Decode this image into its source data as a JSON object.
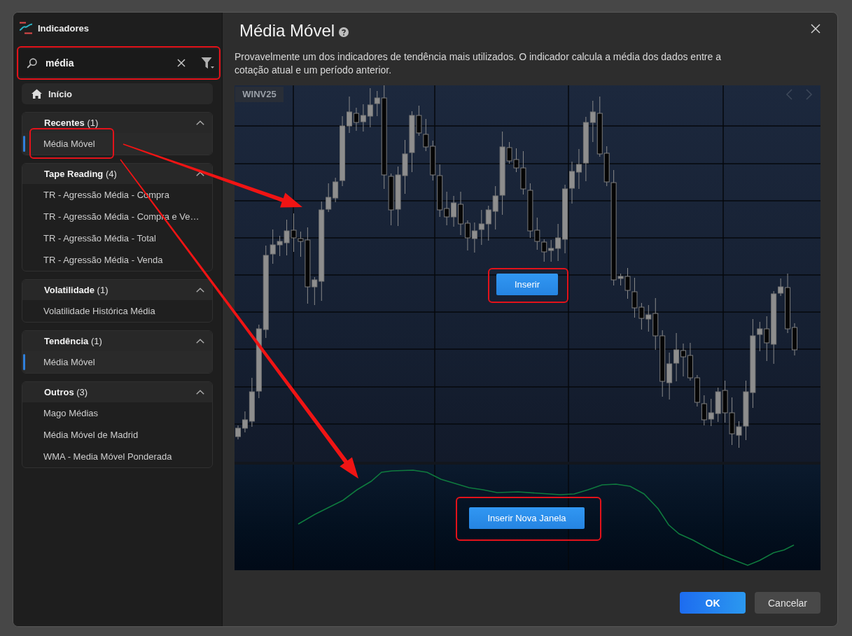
{
  "sidebar": {
    "title": "Indicadores",
    "search": {
      "value": "média"
    },
    "home": {
      "label": "Início"
    },
    "groups": [
      {
        "label": "**Recentes** (1)",
        "expanded": true,
        "items": [
          {
            "label": "Média Móvel",
            "selected": true
          }
        ]
      },
      {
        "label": "**Tape Reading** (4)",
        "expanded": true,
        "items": [
          {
            "label": "TR - Agressão Média - Compra",
            "selected": false
          },
          {
            "label": "TR - Agressão Média - Compra e Ve…",
            "selected": false
          },
          {
            "label": "TR - Agressão Média - Total",
            "selected": false
          },
          {
            "label": "TR - Agressão Média - Venda",
            "selected": false
          }
        ]
      },
      {
        "label": "**Volatilidade** (1)",
        "expanded": true,
        "items": [
          {
            "label": "Volatilidade Histórica Média",
            "selected": false
          }
        ]
      },
      {
        "label": "**Tendência** (1)",
        "expanded": true,
        "items": [
          {
            "label": "Média Móvel",
            "selected": true
          }
        ]
      },
      {
        "label": "**Outros** (3)",
        "expanded": true,
        "items": [
          {
            "label": "Mago Médias",
            "selected": false
          },
          {
            "label": "Média Móvel de Madrid",
            "selected": false
          },
          {
            "label": "WMA - Media Móvel Ponderada",
            "selected": false
          }
        ]
      }
    ]
  },
  "detail": {
    "title": "Média Móvel",
    "description": "Provavelmente um dos indicadores de tendência mais utilizados. O indicador calcula a média dos dados entre a cotação atual e um período anterior.",
    "preview": {
      "symbol": "WINV25",
      "insert_button": {
        "label": "Inserir"
      },
      "new_window_button": {
        "label": "Inserir Nova Janela"
      }
    }
  },
  "footer": {
    "buttons": [
      {
        "label": "OK",
        "kind": "primary"
      },
      {
        "label": "Cancelar",
        "kind": "secondary"
      }
    ]
  }
}
